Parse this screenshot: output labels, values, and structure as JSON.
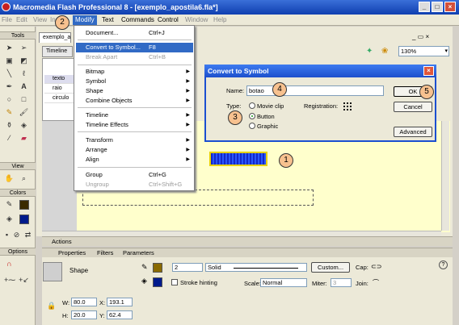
{
  "window": {
    "title": "Macromedia Flash Professional 8 - [exemplo_apostila6.fla*]"
  },
  "menubar": [
    "File",
    "Edit",
    "View",
    "Insert",
    "Modify",
    "Text",
    "Commands",
    "Control",
    "Window",
    "Help"
  ],
  "tools": {
    "tools_label": "Tools",
    "view_label": "View",
    "colors_label": "Colors",
    "options_label": "Options"
  },
  "document": {
    "tab": "exemplo_a",
    "timeline_label": "Timeline",
    "zoom": "130%",
    "layers": [
      "texto",
      "raio",
      "circulo"
    ]
  },
  "modify_menu": {
    "items": [
      {
        "label": "Document...",
        "shortcut": "Ctrl+J"
      },
      {
        "label": "Convert to Symbol...",
        "shortcut": "F8"
      },
      {
        "label": "Break Apart",
        "shortcut": "Ctrl+B"
      },
      {
        "label": "Bitmap"
      },
      {
        "label": "Symbol"
      },
      {
        "label": "Shape"
      },
      {
        "label": "Combine Objects"
      },
      {
        "label": "Timeline"
      },
      {
        "label": "Timeline Effects"
      },
      {
        "label": "Transform"
      },
      {
        "label": "Arrange"
      },
      {
        "label": "Align"
      },
      {
        "label": "Group",
        "shortcut": "Ctrl+G"
      },
      {
        "label": "Ungroup",
        "shortcut": "Ctrl+Shift+G"
      }
    ]
  },
  "dialog": {
    "title": "Convert to Symbol",
    "name_label": "Name:",
    "name_value": "botao",
    "type_label": "Type:",
    "types": [
      "Movie clip",
      "Button",
      "Graphic"
    ],
    "selected_type": "Button",
    "registration_label": "Registration:",
    "ok": "OK",
    "cancel": "Cancel",
    "advanced": "Advanced"
  },
  "markers": [
    "1",
    "2",
    "3",
    "4",
    "5"
  ],
  "panels": {
    "actions": "Actions",
    "tabs": [
      "Properties",
      "Filters",
      "Parameters"
    ]
  },
  "properties": {
    "object_type": "Shape",
    "stroke_size": "2",
    "stroke_style": "Solid",
    "custom": "Custom...",
    "cap_label": "Cap:",
    "join_label": "Join:",
    "stroke_hinting": "Stroke hinting",
    "scale_label": "Scale:",
    "scale_value": "Normal",
    "miter_label": "Miter:",
    "miter_value": "3",
    "w_label": "W:",
    "w": "80.0",
    "x_label": "X:",
    "x": "193.1",
    "h_label": "H:",
    "h": "20.0",
    "y_label": "Y:",
    "y": "62.4"
  },
  "colors": {
    "accent": "#316ac5",
    "stage": "#ffffcc",
    "marker": "#f7c18f"
  }
}
